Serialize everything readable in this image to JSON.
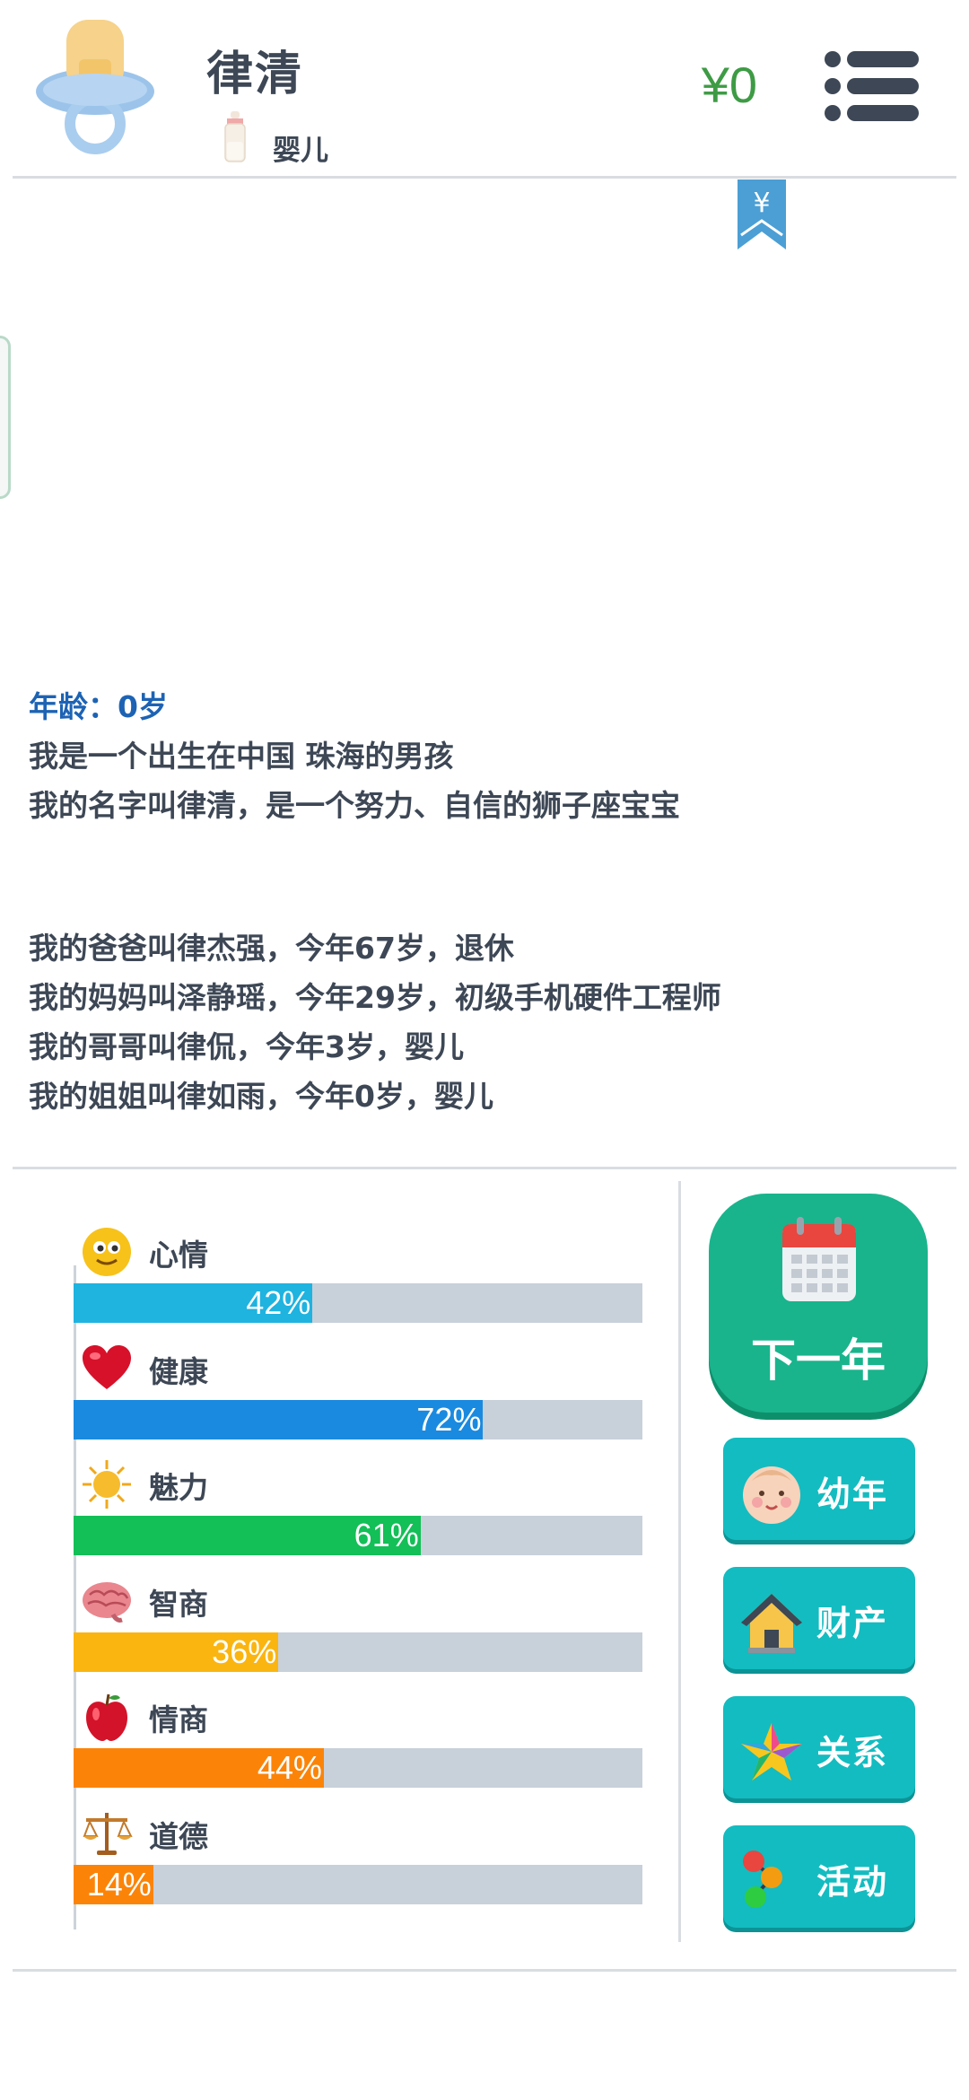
{
  "header": {
    "name": "律清",
    "stage": "婴儿",
    "money": "¥0"
  },
  "bookmark": {
    "symbol": "¥"
  },
  "story": {
    "age_line": "年龄：0岁",
    "lines": [
      "我是一个出生在中国 珠海的男孩",
      "我的名字叫律清，是一个努力、自信的狮子座宝宝"
    ],
    "family": [
      "我的爸爸叫律杰强，今年67岁，退休",
      "我的妈妈叫泽静瑶，今年29岁，初级手机硬件工程师",
      "我的哥哥叫律侃，今年3岁，婴儿",
      "我的姐姐叫律如雨，今年0岁，婴儿"
    ]
  },
  "stats": [
    {
      "label": "心情",
      "value": 42,
      "text": "42%",
      "color": "#1fb3e0",
      "icon": "smiley-icon"
    },
    {
      "label": "健康",
      "value": 72,
      "text": "72%",
      "color": "#1a8ae0",
      "icon": "heart-icon"
    },
    {
      "label": "魅力",
      "value": 61,
      "text": "61%",
      "color": "#13bf57",
      "icon": "sun-icon"
    },
    {
      "label": "智商",
      "value": 36,
      "text": "36%",
      "color": "#fbb511",
      "icon": "brain-icon"
    },
    {
      "label": "情商",
      "value": 44,
      "text": "44%",
      "color": "#fb8408",
      "icon": "apple-icon"
    },
    {
      "label": "道德",
      "value": 14,
      "text": "14%",
      "color": "#fb8408",
      "icon": "scales-icon"
    }
  ],
  "actions": {
    "next_year": "下一年",
    "childhood": "幼年",
    "assets": "财产",
    "relations": "关系",
    "activities": "活动"
  }
}
